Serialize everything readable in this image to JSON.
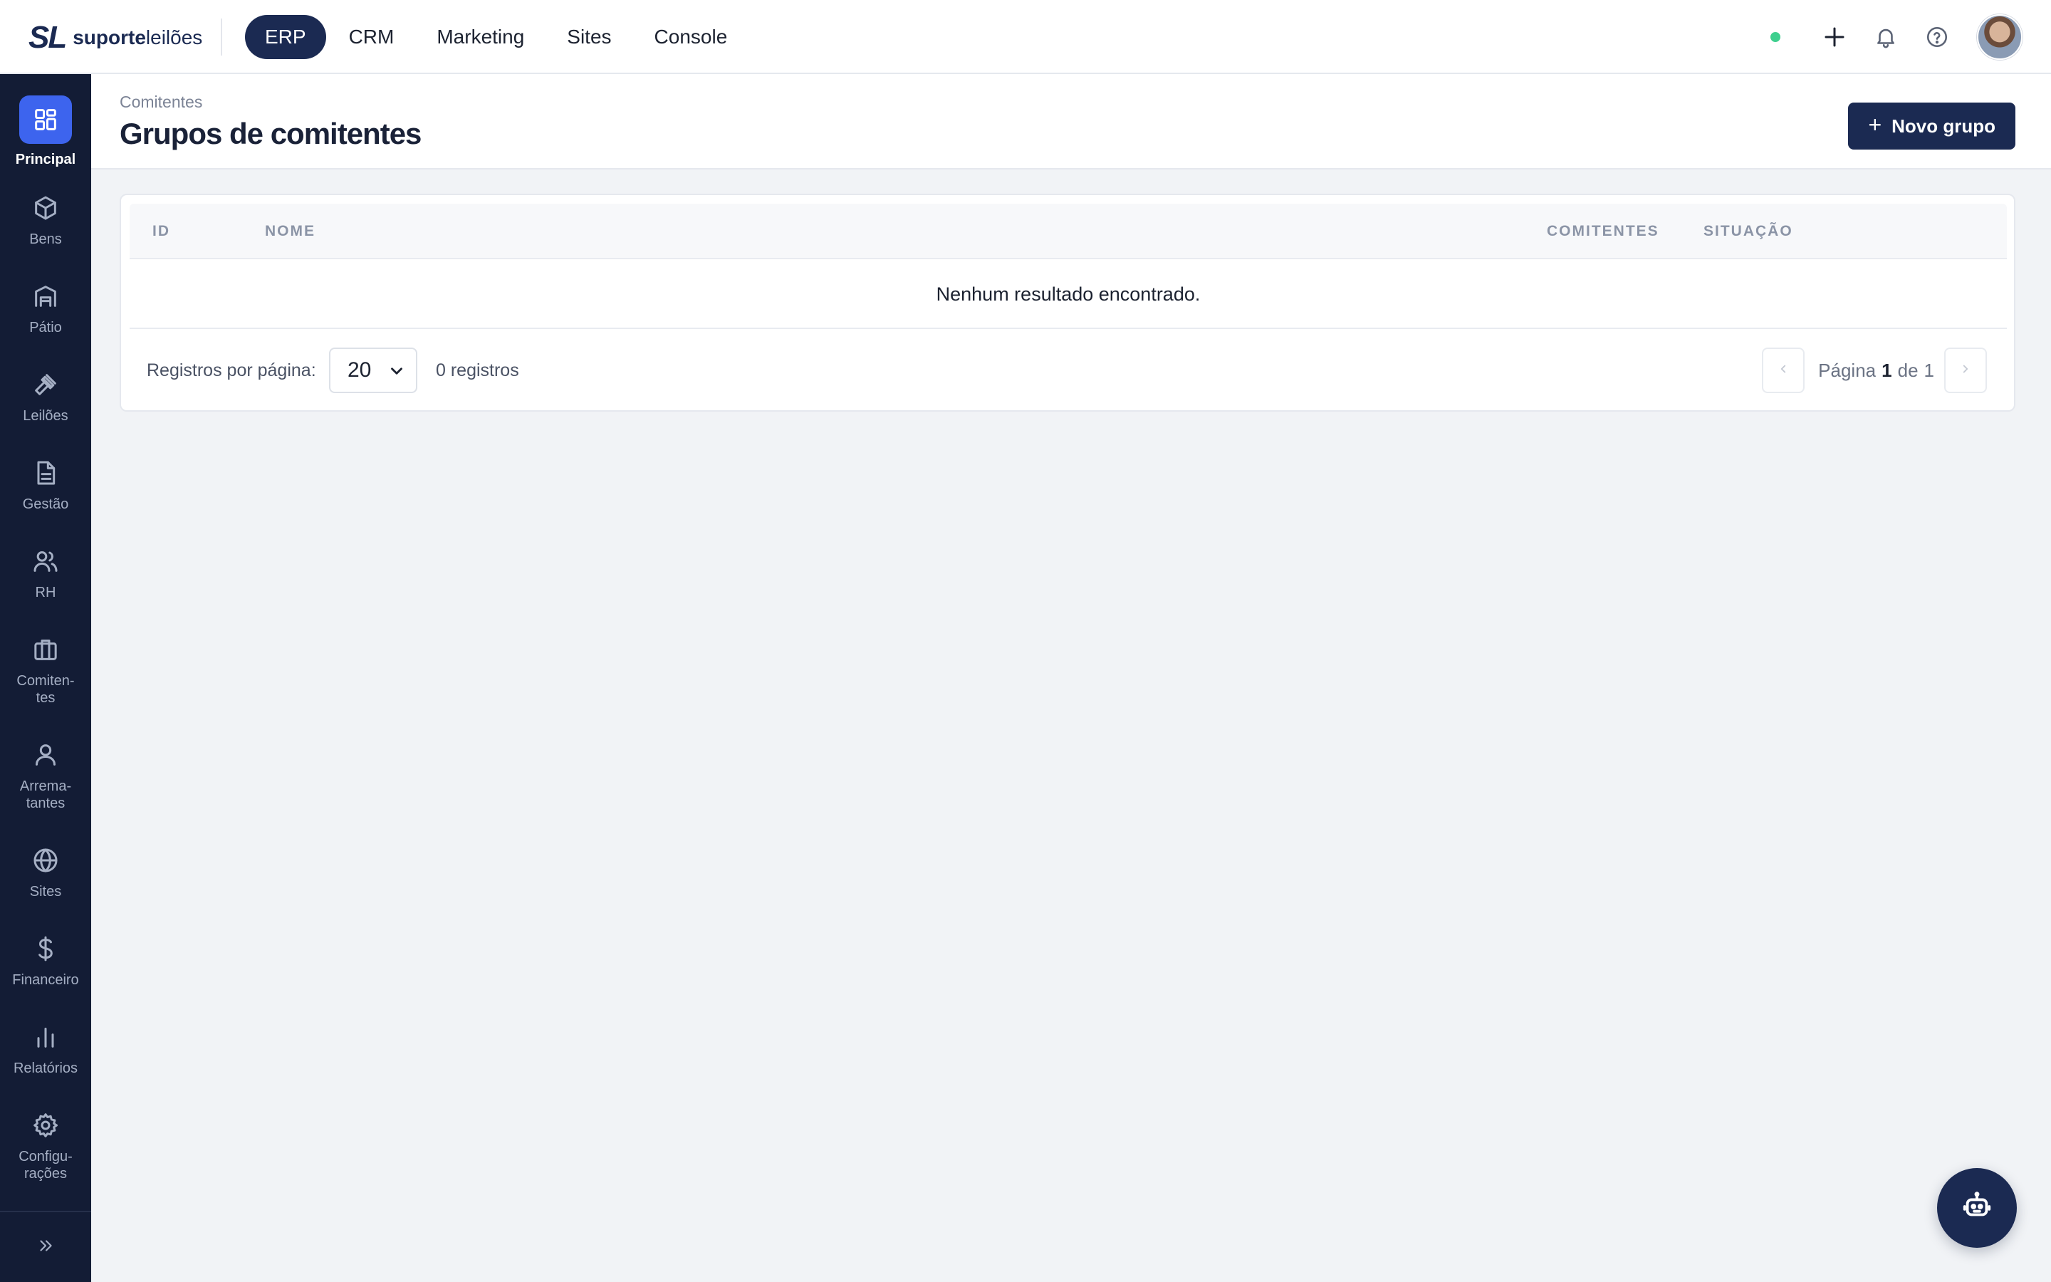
{
  "brand": {
    "mark": "SL",
    "name_bold": "suporte",
    "name_light": "leilões"
  },
  "topnav": [
    {
      "label": "ERP",
      "active": true
    },
    {
      "label": "CRM"
    },
    {
      "label": "Marketing"
    },
    {
      "label": "Sites"
    },
    {
      "label": "Console"
    }
  ],
  "topbar_icons": [
    "status-online",
    "plus-icon",
    "bell-icon",
    "help-icon",
    "avatar"
  ],
  "sidebar": {
    "items": [
      {
        "label": "Principal",
        "icon": "dashboard-icon",
        "active": true
      },
      {
        "label": "Bens",
        "icon": "box-icon"
      },
      {
        "label": "Pátio",
        "icon": "warehouse-icon"
      },
      {
        "label": "Leilões",
        "icon": "gavel-icon"
      },
      {
        "label": "Gestão",
        "icon": "document-icon"
      },
      {
        "label": "RH",
        "icon": "users-icon"
      },
      {
        "label": "Comiten-\ntes",
        "icon": "briefcase-icon"
      },
      {
        "label": "Arrema-\ntantes",
        "icon": "user-icon"
      },
      {
        "label": "Sites",
        "icon": "globe-icon"
      },
      {
        "label": "Financeiro",
        "icon": "dollar-icon"
      },
      {
        "label": "Relatórios",
        "icon": "bar-chart-icon"
      },
      {
        "label": "Configu-\nrações",
        "icon": "gear-icon"
      }
    ]
  },
  "page": {
    "breadcrumb": "Comitentes",
    "title": "Grupos de comitentes",
    "new_button": "Novo grupo",
    "new_button_icon": "+"
  },
  "table": {
    "columns": [
      "ID",
      "NOME",
      "COMITENTES",
      "SITUAÇÃO"
    ],
    "rows": [],
    "empty_message": "Nenhum resultado encontrado."
  },
  "pagination": {
    "per_page_label": "Registros por página:",
    "per_page_value": "20",
    "records": "0 registros",
    "page_label": "Página",
    "current_page": "1",
    "of_label": "de",
    "total_pages": "1"
  },
  "colors": {
    "primary": "#1b2a52",
    "sidebar": "#131c35",
    "accent": "#3d64ee",
    "status": "#3ecf8e"
  }
}
